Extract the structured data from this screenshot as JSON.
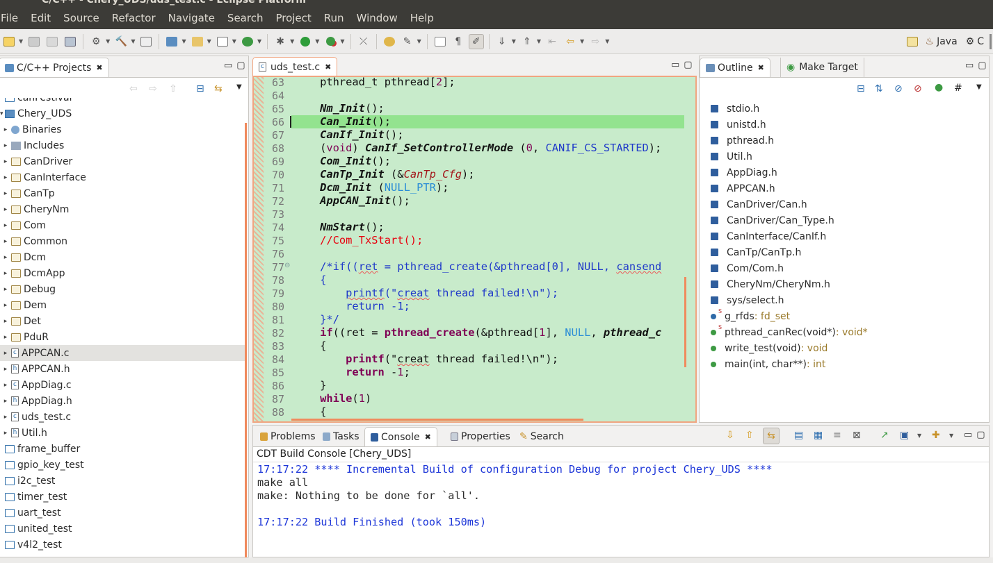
{
  "window": {
    "title": "C/C++ - Chery_UDS/uds_test.c - Eclipse Platform"
  },
  "menu": [
    "File",
    "Edit",
    "Source",
    "Refactor",
    "Navigate",
    "Search",
    "Project",
    "Run",
    "Window",
    "Help"
  ],
  "perspectives": {
    "java": "Java",
    "cpp": "C"
  },
  "project_explorer": {
    "tab_label": "C/C++ Projects",
    "items": [
      {
        "label": "canFestival",
        "type": "project",
        "level": 0,
        "arrow": ""
      },
      {
        "label": "Chery_UDS",
        "type": "project-open",
        "level": 0,
        "arrow": "▾"
      },
      {
        "label": "Binaries",
        "type": "binaries",
        "level": 1,
        "arrow": "▸"
      },
      {
        "label": "Includes",
        "type": "includes",
        "level": 1,
        "arrow": "▸"
      },
      {
        "label": "CanDriver",
        "type": "folder",
        "level": 1,
        "arrow": "▸"
      },
      {
        "label": "CanInterface",
        "type": "folder",
        "level": 1,
        "arrow": "▸"
      },
      {
        "label": "CanTp",
        "type": "folder",
        "level": 1,
        "arrow": "▸"
      },
      {
        "label": "CheryNm",
        "type": "folder",
        "level": 1,
        "arrow": "▸"
      },
      {
        "label": "Com",
        "type": "folder",
        "level": 1,
        "arrow": "▸"
      },
      {
        "label": "Common",
        "type": "folder",
        "level": 1,
        "arrow": "▸"
      },
      {
        "label": "Dcm",
        "type": "folder",
        "level": 1,
        "arrow": "▸"
      },
      {
        "label": "DcmApp",
        "type": "folder",
        "level": 1,
        "arrow": "▸"
      },
      {
        "label": "Debug",
        "type": "folder",
        "level": 1,
        "arrow": "▸"
      },
      {
        "label": "Dem",
        "type": "folder",
        "level": 1,
        "arrow": "▸"
      },
      {
        "label": "Det",
        "type": "folder",
        "level": 1,
        "arrow": "▸"
      },
      {
        "label": "PduR",
        "type": "folder",
        "level": 1,
        "arrow": "▸"
      },
      {
        "label": "APPCAN.c",
        "type": "c",
        "level": 1,
        "arrow": "▸",
        "selected": true
      },
      {
        "label": "APPCAN.h",
        "type": "h",
        "level": 1,
        "arrow": "▸"
      },
      {
        "label": "AppDiag.c",
        "type": "c",
        "level": 1,
        "arrow": "▸"
      },
      {
        "label": "AppDiag.h",
        "type": "h",
        "level": 1,
        "arrow": "▸"
      },
      {
        "label": "uds_test.c",
        "type": "c",
        "level": 1,
        "arrow": "▸"
      },
      {
        "label": "Util.h",
        "type": "h",
        "level": 1,
        "arrow": "▸"
      },
      {
        "label": "frame_buffer",
        "type": "project",
        "level": 0,
        "arrow": ""
      },
      {
        "label": "gpio_key_test",
        "type": "project",
        "level": 0,
        "arrow": ""
      },
      {
        "label": "i2c_test",
        "type": "project",
        "level": 0,
        "arrow": ""
      },
      {
        "label": "timer_test",
        "type": "project",
        "level": 0,
        "arrow": ""
      },
      {
        "label": "uart_test",
        "type": "project",
        "level": 0,
        "arrow": ""
      },
      {
        "label": "united_test",
        "type": "project",
        "level": 0,
        "arrow": ""
      },
      {
        "label": "v4l2_test",
        "type": "project",
        "level": 0,
        "arrow": ""
      }
    ]
  },
  "editor": {
    "tab_label": "uds_test.c",
    "current_line": 66,
    "lines": [
      {
        "n": "63",
        "html": "    pthread_t pthread[<span class='num'>2</span>];"
      },
      {
        "n": "64",
        "html": ""
      },
      {
        "n": "65",
        "html": "    <span class='fn'>Nm_Init</span>();"
      },
      {
        "n": "66",
        "html": "    <span class='fn'>Can_Init</span>();"
      },
      {
        "n": "67",
        "html": "    <span class='fn'>CanIf_Init</span>();"
      },
      {
        "n": "68",
        "html": "    (<span class='num'>void</span>) <span class='fn'>CanIf_SetControllerMode</span> (<span class='num'>0</span>, <span class='bcm'>CANIF_CS_STARTED</span>);"
      },
      {
        "n": "69",
        "html": "    <span class='fn'>Com_Init</span>();"
      },
      {
        "n": "70",
        "html": "    <span class='fn'>CanTp_Init</span> (&amp;<span class='ital'>CanTp_Cfg</span>);"
      },
      {
        "n": "71",
        "html": "    <span class='fn'>Dcm_Init</span> (<span class='mac'>NULL_PTR</span>);"
      },
      {
        "n": "72",
        "html": "    <span class='fn'>AppCAN_Init</span>();"
      },
      {
        "n": "73",
        "html": ""
      },
      {
        "n": "74",
        "html": "    <span class='fn'>NmStart</span>();"
      },
      {
        "n": "75",
        "html": "    <span class='cmt'>//Com_TxStart();</span>"
      },
      {
        "n": "76",
        "html": ""
      },
      {
        "n": "77",
        "html": "    <span class='bcm'>/*if((<span class='sq'>ret</span> = pthread_create(&amp;pthread[0], NULL, <span class='sq'>cansend</span></span>"
      },
      {
        "n": "78",
        "html": "    <span class='bcm'>{</span>"
      },
      {
        "n": "79",
        "html": "        <span class='bcm'><span class='sq'>printf</span>(\"<span class='sq'>creat</span> thread failed!\\n\");</span>"
      },
      {
        "n": "80",
        "html": "        <span class='bcm'>return -1;</span>"
      },
      {
        "n": "81",
        "html": "    <span class='bcm'>}*/</span>"
      },
      {
        "n": "82",
        "html": "    <span class='kw'>if</span>((ret = <span class='kw'>pthread_create</span>(&amp;pthread[<span class='num'>1</span>], <span class='mac'>NULL</span>, <span class='fn'>pthread_c</span>"
      },
      {
        "n": "83",
        "html": "    {"
      },
      {
        "n": "84",
        "html": "        <span class='kw'>printf</span>(\"<span class='sq'>creat</span> thread failed!\\n\");"
      },
      {
        "n": "85",
        "html": "        <span class='kw'>return</span> -<span class='num'>1</span>;"
      },
      {
        "n": "86",
        "html": "    }"
      },
      {
        "n": "87",
        "html": "    <span class='kw'>while</span>(<span class='num'>1</span>)"
      },
      {
        "n": "88",
        "html": "    {"
      }
    ]
  },
  "outline": {
    "tab_label": "Outline",
    "tab2_label": "Make Target",
    "items": [
      {
        "name": "stdio.h",
        "kind": "include",
        "type": ""
      },
      {
        "name": "unistd.h",
        "kind": "include",
        "type": ""
      },
      {
        "name": "pthread.h",
        "kind": "include",
        "type": ""
      },
      {
        "name": "Util.h",
        "kind": "include",
        "type": ""
      },
      {
        "name": "AppDiag.h",
        "kind": "include",
        "type": ""
      },
      {
        "name": "APPCAN.h",
        "kind": "include",
        "type": ""
      },
      {
        "name": "CanDriver/Can.h",
        "kind": "include",
        "type": ""
      },
      {
        "name": "CanDriver/Can_Type.h",
        "kind": "include",
        "type": ""
      },
      {
        "name": "CanInterface/CanIf.h",
        "kind": "include",
        "type": ""
      },
      {
        "name": "CanTp/CanTp.h",
        "kind": "include",
        "type": ""
      },
      {
        "name": "Com/Com.h",
        "kind": "include",
        "type": ""
      },
      {
        "name": "CheryNm/CheryNm.h",
        "kind": "include",
        "type": ""
      },
      {
        "name": "sys/select.h",
        "kind": "include",
        "type": ""
      },
      {
        "name": "g_rfds",
        "kind": "static-var",
        "type": " : fd_set"
      },
      {
        "name": "pthread_canRec(void*)",
        "kind": "static-func",
        "type": " : void*"
      },
      {
        "name": "write_test(void)",
        "kind": "func",
        "type": " : void"
      },
      {
        "name": "main(int, char**)",
        "kind": "func",
        "type": " : int"
      }
    ]
  },
  "bottom_panel": {
    "tabs": [
      "Problems",
      "Tasks",
      "Console",
      "Properties",
      "Search"
    ],
    "active_tab": "Console",
    "console_title": "CDT Build Console [Chery_UDS]",
    "lines": [
      {
        "text": "17:17:22 **** Incremental Build of configuration Debug for project Chery_UDS ****",
        "color": "blue"
      },
      {
        "text": "make all",
        "color": "black"
      },
      {
        "text": "make: Nothing to be done for `all'.",
        "color": "black"
      },
      {
        "text": "",
        "color": "black"
      },
      {
        "text": "17:17:22 Build Finished (took 150ms)",
        "color": "blue"
      }
    ]
  },
  "colors": {
    "editor_bg": "#c8ebcb",
    "current_line": "#93e38f",
    "menubar_bg": "#3c3b37",
    "accent_orange": "#f08a5d"
  }
}
